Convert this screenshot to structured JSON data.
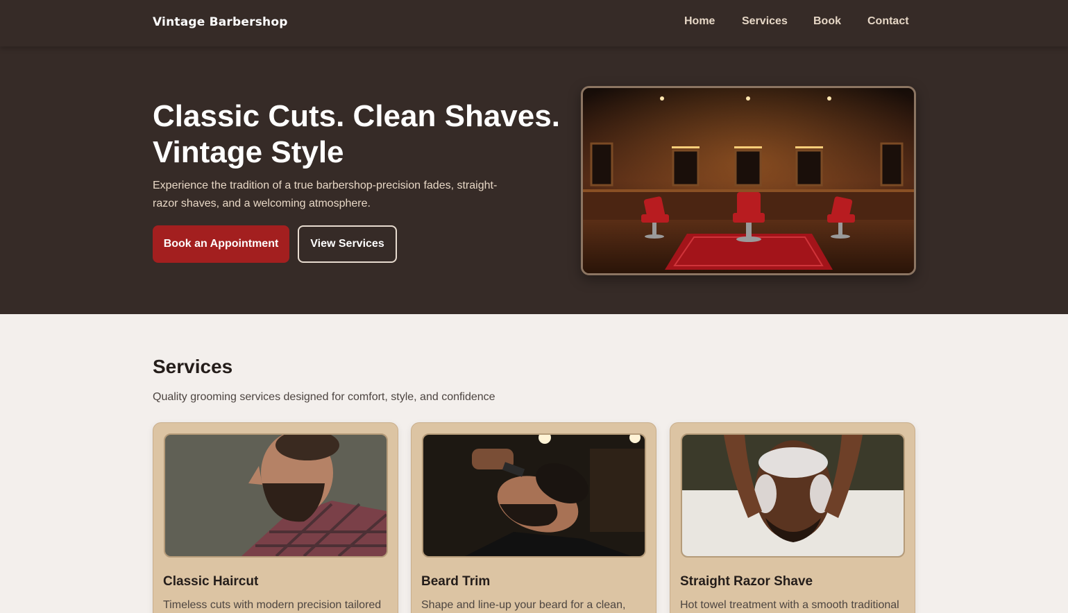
{
  "nav": {
    "brand": "Vintage Barbershop",
    "links": [
      {
        "label": "Home"
      },
      {
        "label": "Services"
      },
      {
        "label": "Book"
      },
      {
        "label": "Contact"
      }
    ]
  },
  "hero": {
    "title_line1": "Classic Cuts. Clean Shaves.",
    "title_line2": "Vintage Style",
    "subtitle": "Experience the tradition of a true barbershop-precision fades, straight-razor shaves, and a welcoming atmosphere.",
    "primary_button": "Book an Appointment",
    "secondary_button": "View Services"
  },
  "services": {
    "title": "Services",
    "subtitle": "Quality grooming services designed for comfort, style, and confidence",
    "cards": [
      {
        "title": "Classic Haircut",
        "description": "Timeless cuts with modern precision tailored"
      },
      {
        "title": "Beard Trim",
        "description": "Shape and line-up your beard for a clean,"
      },
      {
        "title": "Straight Razor Shave",
        "description": "Hot towel treatment with a smooth traditional"
      }
    ]
  },
  "colors": {
    "header_bg": "#362b27",
    "accent_red": "#a31f1f",
    "card_bg": "#dcc4a3",
    "page_bg": "#f3efec"
  }
}
